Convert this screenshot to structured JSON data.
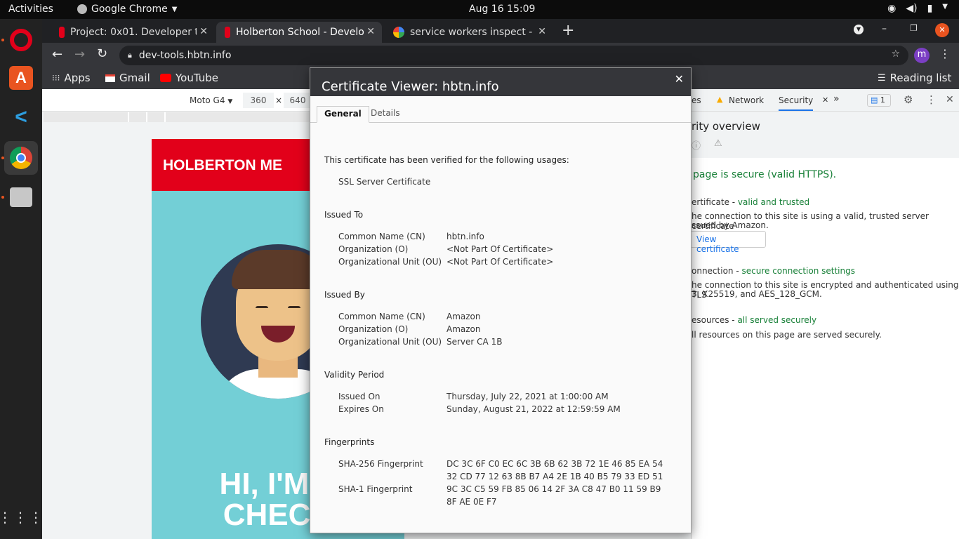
{
  "topbar": {
    "activities": "Activities",
    "app": "Google Chrome",
    "clock": "Aug 16  15:09"
  },
  "tabs": [
    {
      "title": "Project: 0x01. Developer t"
    },
    {
      "title": "Holberton School - Develo"
    },
    {
      "title": "service workers inspect - C"
    }
  ],
  "omnibox": {
    "url": "dev-tools.hbtn.info"
  },
  "account_initial": "m",
  "bookmarks": {
    "apps": "Apps",
    "gmail": "Gmail",
    "youtube": "YouTube",
    "reading_list": "Reading list"
  },
  "device_bar": {
    "device": "Moto G4",
    "width": "360",
    "times": "×",
    "height": "640"
  },
  "mobile_page": {
    "header": "HOLBERTON ME",
    "hero_line1": "HI, I'M T",
    "hero_line2": "CHECK"
  },
  "devtools": {
    "tabs": {
      "partial": "es",
      "network": "Network",
      "security": "Security",
      "more": "»",
      "issues": "1"
    },
    "overview_title": "rity overview",
    "secure_msg": "page is secure (valid HTTPS).",
    "cert_label": "ertificate - ",
    "cert_status": "valid and trusted",
    "cert_desc_1": "he connection to this site is using a valid, trusted server certificate",
    "cert_desc_2": "ssued by Amazon.",
    "view_cert_button": "View certificate",
    "conn_label": "onnection - ",
    "conn_status": "secure connection settings",
    "conn_desc_1": "he connection to this site is encrypted and authenticated using TLS",
    "conn_desc_2": "3, X25519, and AES_128_GCM.",
    "res_label": "esources - ",
    "res_status": "all served securely",
    "res_desc": "ll resources on this page are served securely."
  },
  "modal": {
    "title": "Certificate Viewer: hbtn.info",
    "close": "✕",
    "tab_general": "General",
    "tab_details": "Details",
    "verified_text": "This certificate has been verified for the following usages:",
    "usage": "SSL Server Certificate",
    "issued_to": {
      "heading": "Issued To",
      "rows": [
        {
          "label": "Common Name (CN)",
          "value": "hbtn.info"
        },
        {
          "label": "Organization (O)",
          "value": "<Not Part Of Certificate>"
        },
        {
          "label": "Organizational Unit (OU)",
          "value": "<Not Part Of Certificate>"
        }
      ]
    },
    "issued_by": {
      "heading": "Issued By",
      "rows": [
        {
          "label": "Common Name (CN)",
          "value": "Amazon"
        },
        {
          "label": "Organization (O)",
          "value": "Amazon"
        },
        {
          "label": "Organizational Unit (OU)",
          "value": "Server CA 1B"
        }
      ]
    },
    "validity": {
      "heading": "Validity Period",
      "rows": [
        {
          "label": "Issued On",
          "value": "Thursday, July 22, 2021 at 1:00:00 AM"
        },
        {
          "label": "Expires On",
          "value": "Sunday, August 21, 2022 at 12:59:59 AM"
        }
      ]
    },
    "fingerprints": {
      "heading": "Fingerprints",
      "sha256_label": "SHA-256 Fingerprint",
      "sha256_line1": "DC 3C 6F C0 EC 6C 3B 6B 62 3B 72 1E 46 85 EA 54",
      "sha256_line2": "32 CD 77 12 63 8B B7 A4 2E 1B 40 B5 79 33 ED 51",
      "sha1_label": "SHA-1 Fingerprint",
      "sha1_line1": "9C 3C C5 59 FB 85 06 14 2F 3A C8 47 B0 11 59 B9",
      "sha1_line2": "8F AE 0E F7"
    }
  },
  "colors": {
    "accent_red": "#e2001a",
    "teal": "#73cfd6",
    "secure_green": "#188038",
    "link_blue": "#1a73e8"
  }
}
